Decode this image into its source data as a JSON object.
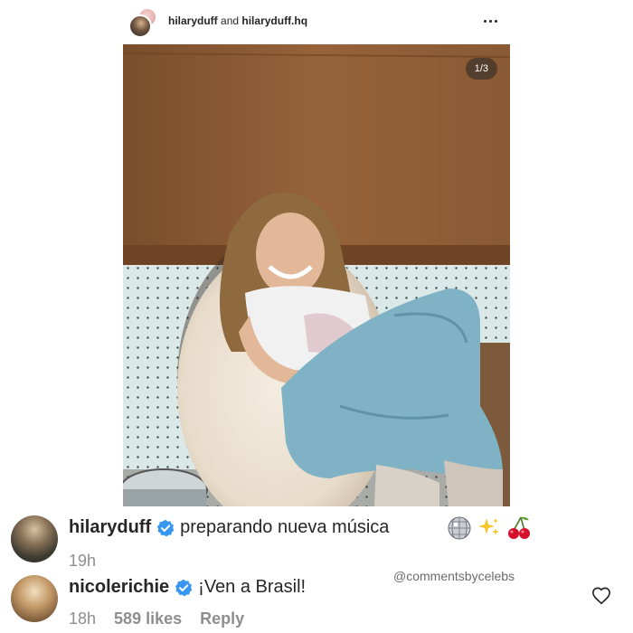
{
  "post": {
    "author_1": "hilaryduff",
    "connector": "and",
    "author_2": "hilaryduff.hq",
    "slide_counter": "1/3"
  },
  "comments": [
    {
      "username": "hilaryduff",
      "verified": true,
      "text": "preparando nueva música",
      "emojis": [
        "mirror-ball-emoji",
        "sparkles-emoji",
        "cherries-emoji"
      ],
      "time": "19h"
    },
    {
      "username": "nicolerichie",
      "verified": true,
      "text": "¡Ven a Brasil!",
      "time": "18h",
      "likes": "589 likes",
      "reply_label": "Reply"
    }
  ],
  "watermark": "@commentsbycelebs",
  "colors": {
    "verified_blue": "#3897f0",
    "meta_gray": "#8e8e8e",
    "wall_wood": "#8e5c34",
    "pegboard": "#d9e6e6",
    "jeans": "#7fb2c4"
  }
}
